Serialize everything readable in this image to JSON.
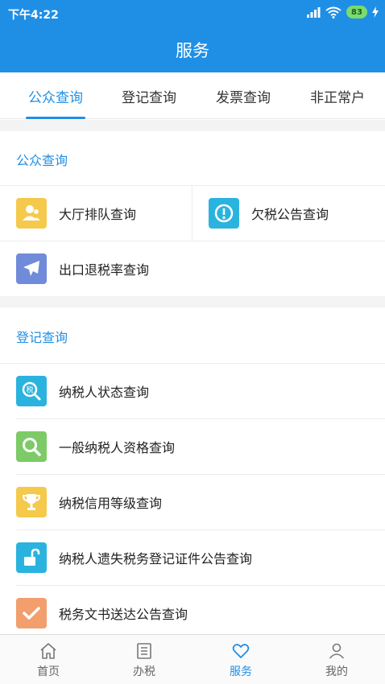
{
  "status_bar": {
    "time": "下午4:22",
    "battery": "83"
  },
  "header": {
    "title": "服务"
  },
  "tabs": [
    {
      "label": "公众查询",
      "active": true
    },
    {
      "label": "登记查询",
      "active": false
    },
    {
      "label": "发票查询",
      "active": false
    },
    {
      "label": "非正常户",
      "active": false
    }
  ],
  "sections": [
    {
      "title": "公众查询",
      "items": [
        {
          "label": "大厅排队查询",
          "icon": "queue-person-icon",
          "color": "#f5c94b"
        },
        {
          "label": "欠税公告查询",
          "icon": "alert-icon",
          "color": "#2ab3de"
        },
        {
          "label": "出口退税率查询",
          "icon": "airplane-icon",
          "color": "#6f8bd9"
        }
      ]
    },
    {
      "title": "登记查询",
      "items": [
        {
          "label": "纳税人状态查询",
          "icon": "tax-search-icon",
          "color": "#2ab3de"
        },
        {
          "label": "一般纳税人资格查询",
          "icon": "search-icon",
          "color": "#7ccb66"
        },
        {
          "label": "纳税信用等级查询",
          "icon": "trophy-icon",
          "color": "#f5c94b"
        },
        {
          "label": "纳税人遗失税务登记证件公告查询",
          "icon": "unlock-icon",
          "color": "#2ab3de"
        },
        {
          "label": "税务文书送达公告查询",
          "icon": "checkmark-icon",
          "color": "#f29e6d"
        }
      ]
    }
  ],
  "bottom_nav": [
    {
      "label": "首页",
      "icon": "home-icon",
      "active": false
    },
    {
      "label": "办税",
      "icon": "list-icon",
      "active": false
    },
    {
      "label": "服务",
      "icon": "heart-icon",
      "active": true
    },
    {
      "label": "我的",
      "icon": "user-icon",
      "active": false
    }
  ],
  "colors": {
    "primary": "#1f8fe6",
    "background_gap": "#f3f3f3"
  }
}
